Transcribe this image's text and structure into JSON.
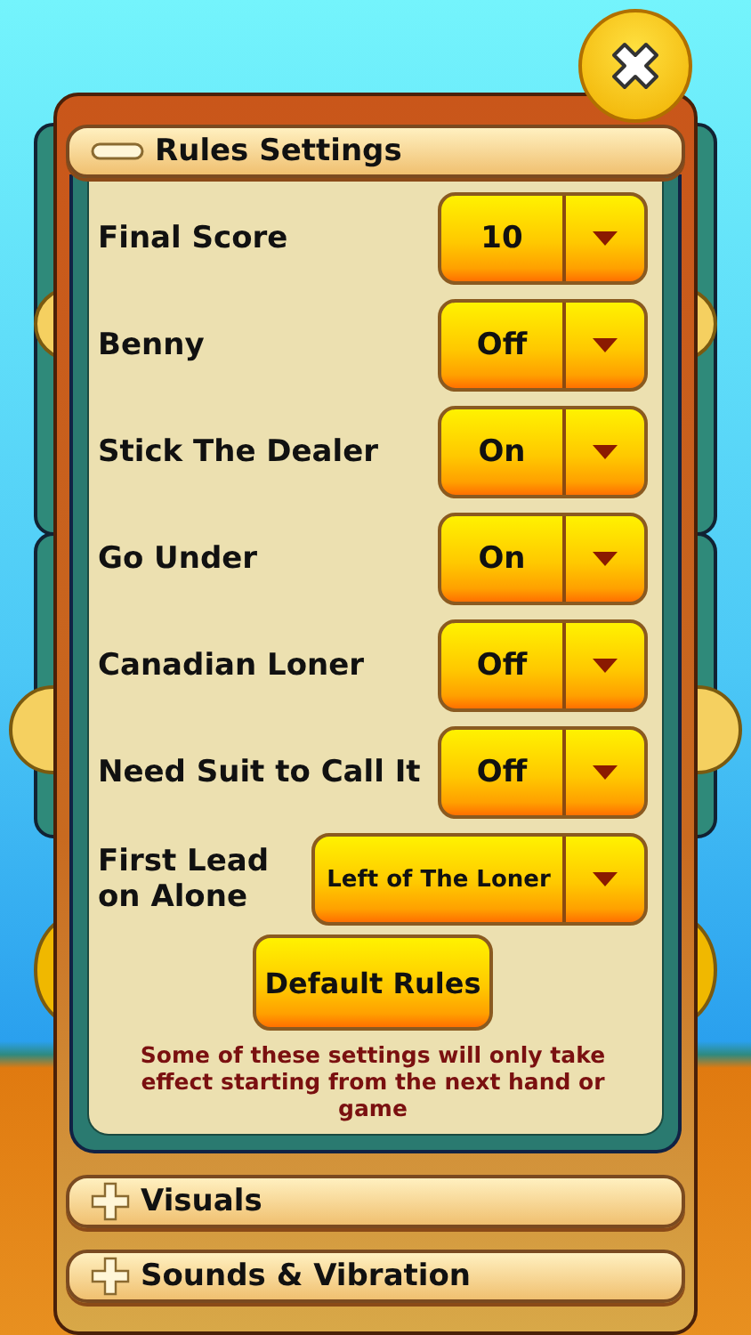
{
  "sections": [
    {
      "title": "Rules Settings",
      "expanded": true
    },
    {
      "title": "Visuals",
      "expanded": false
    },
    {
      "title": "Sounds & Vibration",
      "expanded": false
    }
  ],
  "rules": {
    "settings": [
      {
        "label": "Final Score",
        "value": "10"
      },
      {
        "label": "Benny",
        "value": "Off"
      },
      {
        "label": "Stick The Dealer",
        "value": "On"
      },
      {
        "label": "Go Under",
        "value": "On"
      },
      {
        "label": "Canadian Loner",
        "value": "Off"
      },
      {
        "label": "Need Suit to Call It",
        "value": "Off"
      },
      {
        "label": "First Lead on Alone",
        "value": "Left of The Loner",
        "kind": "wide"
      }
    ],
    "default_button": "Default Rules",
    "note": "Some of these settings will only take effect starting from the next hand or game"
  }
}
